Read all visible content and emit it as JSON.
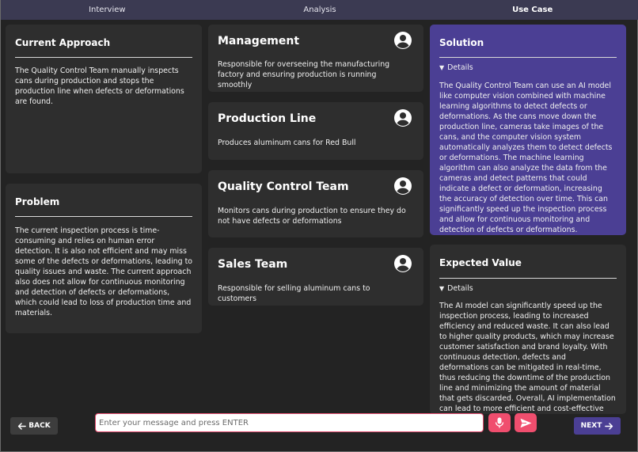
{
  "tabs": [
    {
      "label": "Interview"
    },
    {
      "label": "Analysis"
    },
    {
      "label": "Use Case"
    }
  ],
  "current_approach": {
    "title": "Current Approach",
    "body": "The Quality Control Team manually inspects cans during production and stops the production line when defects or deformations are found."
  },
  "problem": {
    "title": "Problem",
    "body": "The current inspection process is time-consuming and relies on human error detection. It is also not efficient and may miss some of the defects or deformations, leading to quality issues and waste. The current approach also does not allow for continuous monitoring and detection of defects or deformations, which could lead to loss of production time and materials."
  },
  "stakeholders": [
    {
      "name": "Management",
      "description": "Responsible for overseeing the manufacturing factory and ensuring production is running smoothly"
    },
    {
      "name": "Production Line",
      "description": "Produces aluminum cans for Red Bull"
    },
    {
      "name": "Quality Control Team",
      "description": "Monitors cans during production to ensure they do not have defects or deformations"
    },
    {
      "name": "Sales Team",
      "description": "Responsible for selling aluminum cans to customers"
    }
  ],
  "solution": {
    "title": "Solution",
    "details_label": "Details",
    "body": "The Quality Control Team can use an AI model like computer vision combined with machine learning algorithms to detect defects or deformations. As the cans move down the production line, cameras take images of the cans, and the computer vision system automatically analyzes them to detect defects or deformations. The machine learning algorithm can also analyze the data from the cameras and detect patterns that could indicate a defect or deformation, increasing the accuracy of detection over time. This can significantly speed up the inspection process and allow for continuous monitoring and detection of defects or deformations."
  },
  "expected_value": {
    "title": "Expected Value",
    "details_label": "Details",
    "body": "The AI model can significantly speed up the inspection process, leading to increased efficiency and reduced waste. It can also lead to higher quality products, which may increase customer satisfaction and brand loyalty. With continuous detection, defects and deformations can be mitigated in real-time, thus reducing the downtime of the production line and minimizing the amount of material that gets discarded. Overall, AI implementation can lead to more efficient and cost-effective production processes"
  },
  "footer": {
    "back_label": "BACK",
    "next_label": "NEXT",
    "input_placeholder": "Enter your message and press ENTER"
  },
  "colors": {
    "accent": "#4b3f94",
    "send": "#f04e6e",
    "card": "#2e2e2e",
    "background": "#232323"
  }
}
